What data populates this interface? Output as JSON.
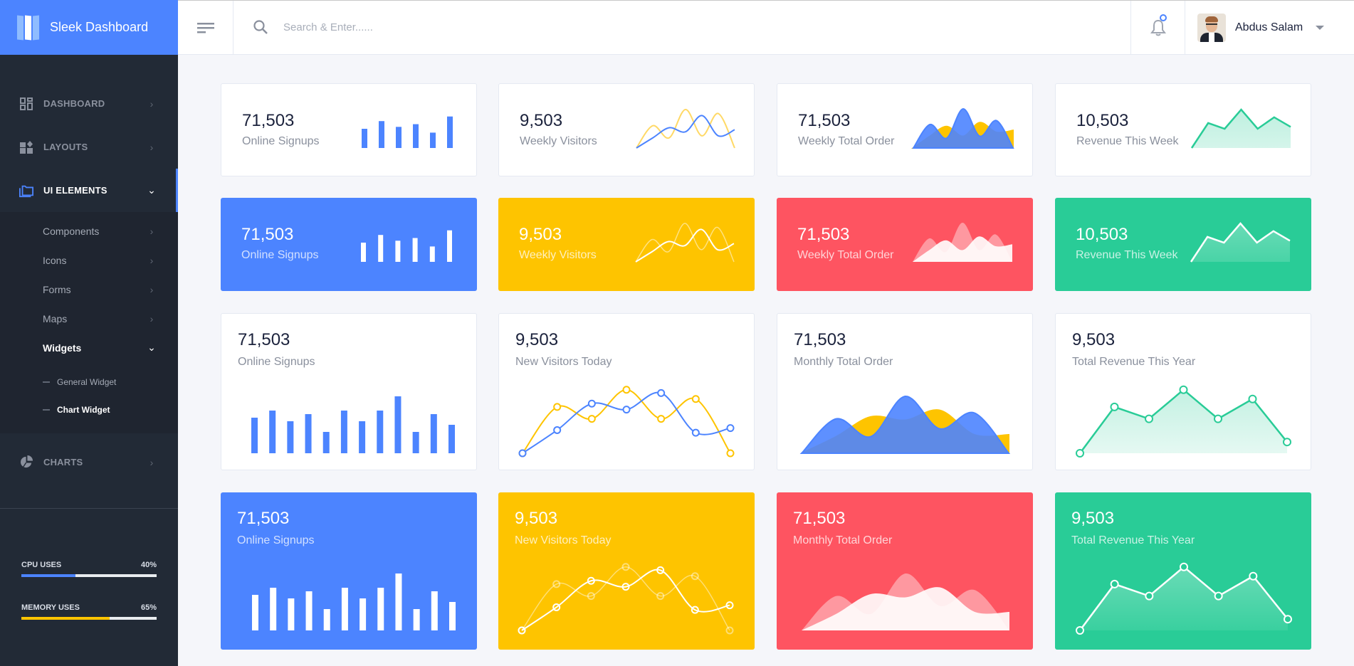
{
  "brand": {
    "name": "Sleek Dashboard",
    "color": "#4c84ff"
  },
  "header": {
    "search_placeholder": "Search & Enter......",
    "user_name": "Abdus Salam"
  },
  "sidebar": {
    "items": [
      {
        "label": "DASHBOARD",
        "icon": "dashboard-icon",
        "active": false
      },
      {
        "label": "LAYOUTS",
        "icon": "layouts-icon",
        "active": false
      },
      {
        "label": "UI ELEMENTS",
        "icon": "folder-icon",
        "active": true,
        "expanded": true
      },
      {
        "label": "CHARTS",
        "icon": "pie-chart-icon",
        "active": false
      }
    ],
    "ui_elements_sub": [
      {
        "label": "Components"
      },
      {
        "label": "Icons"
      },
      {
        "label": "Forms"
      },
      {
        "label": "Maps"
      },
      {
        "label": "Widgets",
        "active": true,
        "expanded": true
      }
    ],
    "widgets_sub": [
      {
        "label": "General Widget",
        "active": false
      },
      {
        "label": "Chart Widget",
        "active": true
      }
    ],
    "usage": [
      {
        "label": "CPU USES",
        "value": "40%",
        "percent": 40,
        "color": "#4c84ff"
      },
      {
        "label": "MEMORY USES",
        "value": "65%",
        "percent": 65,
        "color": "#fec400"
      }
    ]
  },
  "colors": {
    "blue": "#4c84ff",
    "yellow": "#fec400",
    "red": "#fe5461",
    "green": "#29cc97"
  },
  "cards": [
    {
      "value": "71,503",
      "label": "Online Signups",
      "chart": "bar",
      "theme": "white"
    },
    {
      "value": "9,503",
      "label": "Weekly Visitors",
      "chart": "curve",
      "theme": "white"
    },
    {
      "value": "71,503",
      "label": "Weekly Total Order",
      "chart": "area",
      "theme": "white"
    },
    {
      "value": "10,503",
      "label": "Revenue This Week",
      "chart": "line-area",
      "theme": "white"
    },
    {
      "value": "71,503",
      "label": "Online Signups",
      "chart": "bar",
      "theme": "blue"
    },
    {
      "value": "9,503",
      "label": "Weekly Visitors",
      "chart": "curve",
      "theme": "yellow"
    },
    {
      "value": "71,503",
      "label": "Weekly Total Order",
      "chart": "area",
      "theme": "red"
    },
    {
      "value": "10,503",
      "label": "Revenue This Week",
      "chart": "line-area",
      "theme": "green"
    },
    {
      "value": "71,503",
      "label": "Online Signups",
      "chart": "bar",
      "theme": "white"
    },
    {
      "value": "9,503",
      "label": "New Visitors Today",
      "chart": "curve-points",
      "theme": "white"
    },
    {
      "value": "71,503",
      "label": "Monthly Total Order",
      "chart": "area",
      "theme": "white"
    },
    {
      "value": "9,503",
      "label": "Total Revenue This Year",
      "chart": "line-area-points",
      "theme": "white"
    },
    {
      "value": "71,503",
      "label": "Online Signups",
      "chart": "bar",
      "theme": "blue"
    },
    {
      "value": "9,503",
      "label": "New Visitors Today",
      "chart": "curve-points",
      "theme": "yellow"
    },
    {
      "value": "71,503",
      "label": "Monthly Total Order",
      "chart": "area",
      "theme": "red"
    },
    {
      "value": "9,503",
      "label": "Total Revenue This Year",
      "chart": "line-area-points",
      "theme": "green"
    }
  ],
  "chart_data": [
    {
      "id": "signups-small",
      "type": "bar",
      "values": [
        50,
        70,
        55,
        62,
        40,
        82
      ],
      "ylim": [
        0,
        100
      ]
    },
    {
      "id": "visitors-small",
      "type": "line",
      "series": [
        {
          "name": "series-a",
          "values": [
            0,
            55,
            25,
            95,
            30,
            85,
            0
          ]
        },
        {
          "name": "series-b",
          "values": [
            0,
            25,
            50,
            40,
            80,
            30,
            45
          ]
        }
      ],
      "ylim": [
        0,
        100
      ]
    },
    {
      "id": "orders-small",
      "type": "area",
      "series": [
        {
          "name": "series-a",
          "values": [
            0,
            30,
            55,
            30,
            65,
            40,
            45
          ]
        },
        {
          "name": "series-b",
          "values": [
            0,
            60,
            25,
            100,
            30,
            70,
            0
          ]
        }
      ],
      "ylim": [
        0,
        100
      ]
    },
    {
      "id": "revenue-small",
      "type": "area",
      "values": [
        0,
        65,
        50,
        100,
        50,
        80,
        55
      ],
      "ylim": [
        0,
        100
      ]
    },
    {
      "id": "signups-large",
      "type": "bar",
      "values": [
        50,
        60,
        45,
        55,
        30,
        60,
        45,
        60,
        80,
        30,
        55,
        40
      ],
      "ylim": [
        0,
        100
      ]
    },
    {
      "id": "visitors-large",
      "type": "line",
      "series": [
        {
          "name": "series-a",
          "values": [
            0,
            70,
            52,
            96,
            52,
            82,
            0
          ]
        },
        {
          "name": "series-b",
          "values": [
            0,
            35,
            75,
            66,
            91,
            31,
            38
          ]
        }
      ],
      "ylim": [
        0,
        100
      ]
    },
    {
      "id": "orders-large",
      "type": "area",
      "series": [
        {
          "name": "series-a",
          "values": [
            0,
            25,
            55,
            50,
            65,
            28,
            28
          ]
        },
        {
          "name": "series-b",
          "values": [
            0,
            52,
            25,
            86,
            37,
            61,
            0
          ]
        }
      ],
      "ylim": [
        0,
        100
      ]
    },
    {
      "id": "revenue-large",
      "type": "area",
      "values": [
        0,
        70,
        52,
        96,
        52,
        82,
        17
      ],
      "ylim": [
        0,
        100
      ]
    }
  ]
}
